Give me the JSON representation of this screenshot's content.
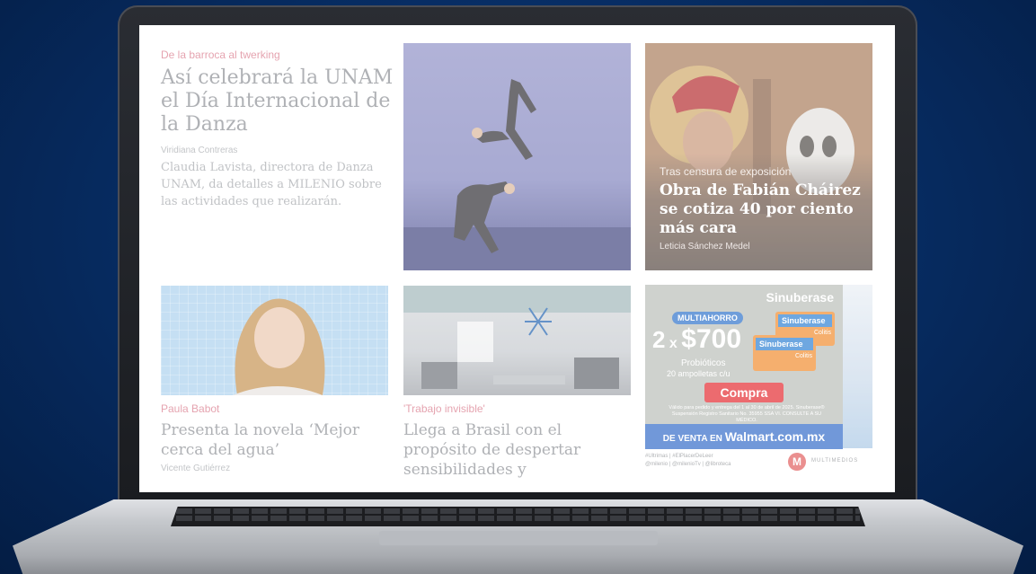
{
  "article_1": {
    "kicker": "De la barroca al twerking",
    "headline": "Así celebrará la UNAM el Día Internacional de la Danza",
    "byline": "Viridiana Contreras",
    "summary": "Claudia Lavista, directora de Danza UNAM, da detalles a MILENIO sobre las actividades que realizarán."
  },
  "feature": {
    "kicker": "Tras censura de exposición",
    "headline": "Obra de Fabián Cháirez se cotiza 40 por ciento más cara",
    "byline": "Leticia Sánchez Medel"
  },
  "article_2": {
    "kicker": "Paula Babot",
    "headline": "Presenta la novela ‘Mejor cerca del agua’",
    "byline": "Vicente Gutiérrez"
  },
  "article_3": {
    "kicker": "'Trabajo invisible'",
    "headline": "Llega a Brasil con el propósito de despertar sensibilidades y"
  },
  "ad": {
    "brand": "Sinuberase",
    "pill": "MULTIAHORRO",
    "promo_count": "2",
    "promo_x": "x",
    "promo_price": "$700",
    "product": "Probióticos",
    "quantity": "20 ampolletas c/u",
    "box_label": "Sinuberase",
    "box_sub": "Colitis",
    "buy_label": "Compra",
    "legal": "Válido para pedido y entrega del 1 al 30 de abril de 2025. Sinuberase® Suspensión Registro Sanitario No. 35955 SSA VI. CONSULTE A SU MÉDICO.",
    "footer_prefix": "DE VENTA EN",
    "footer_store": "Walmart.com.mx",
    "colors": {
      "accent": "#2e67c8",
      "buy": "#e3262c"
    }
  },
  "social": {
    "line1": "#Ultrimas | #ElPlacerDeLeer",
    "line2": "@milenio | @milenioTv | @libroteca",
    "logo": "M",
    "logo_text": "MULTIMEDIOS"
  }
}
